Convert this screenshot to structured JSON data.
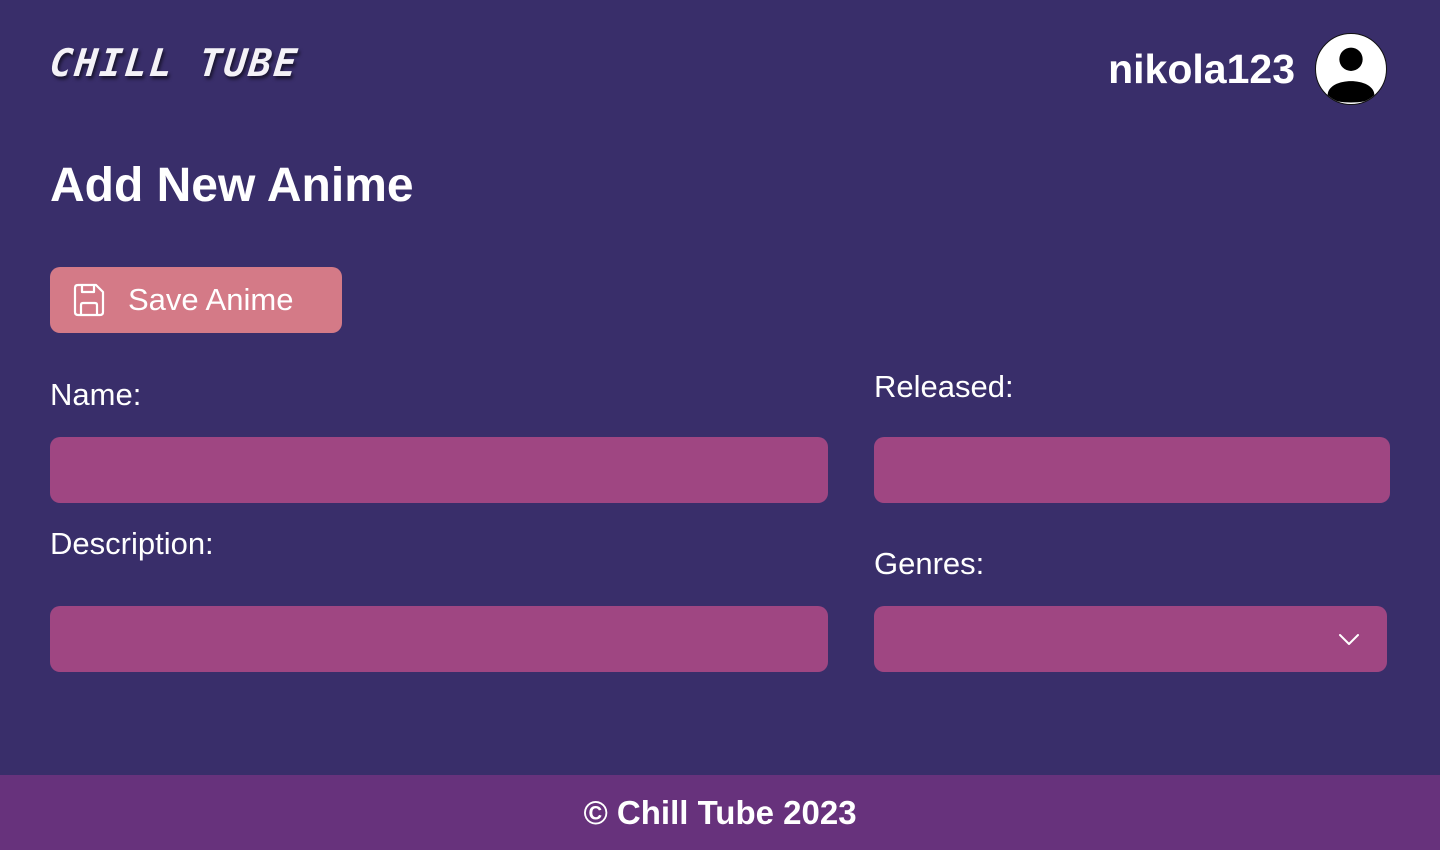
{
  "header": {
    "logo_text": "CHILL TUBE",
    "username": "nikola123",
    "avatar_icon": "user-avatar-icon"
  },
  "page": {
    "title": "Add New Anime"
  },
  "toolbar": {
    "save_label": "Save Anime",
    "save_icon": "floppy-disk-icon"
  },
  "form": {
    "name": {
      "label": "Name:",
      "value": "",
      "placeholder": ""
    },
    "released": {
      "label": "Released:",
      "value": "",
      "placeholder": ""
    },
    "description": {
      "label": "Description:",
      "value": "",
      "placeholder": ""
    },
    "genres": {
      "label": "Genres:",
      "selected": ""
    }
  },
  "footer": {
    "text": "© Chill Tube 2023"
  },
  "colors": {
    "background": "#392e6a",
    "input": "#9f4682",
    "button": "#d47a87",
    "footer": "#67327c",
    "text": "#ffffff"
  }
}
